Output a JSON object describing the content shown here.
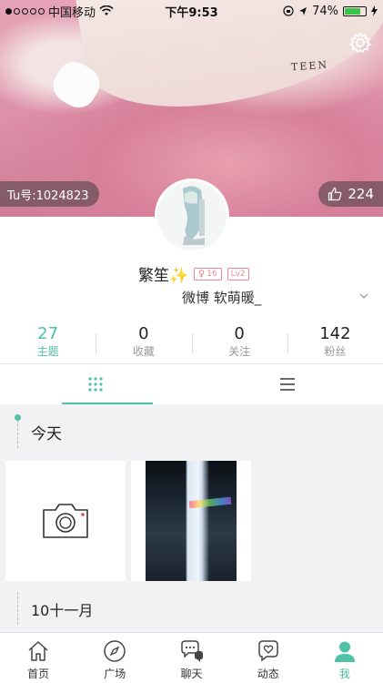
{
  "status_bar": {
    "carrier": "中国移动",
    "time": "下午9:53",
    "battery_percent": "74%",
    "signal_bars_filled": 1
  },
  "cover": {
    "tu_id": "Tu号:1024823",
    "likes": "224"
  },
  "profile": {
    "name": "繁笙✨",
    "age_badge": "16",
    "level_badge": "Lv2",
    "weibo": "微博 软萌暖_"
  },
  "stats": [
    {
      "num": "27",
      "label": "主题"
    },
    {
      "num": "0",
      "label": "收藏"
    },
    {
      "num": "0",
      "label": "关注"
    },
    {
      "num": "142",
      "label": "粉丝"
    }
  ],
  "timeline": {
    "date_today": "今天",
    "date_next": "10十一月"
  },
  "tabbar": [
    {
      "label": "首页",
      "icon": "home-icon"
    },
    {
      "label": "广场",
      "icon": "compass-icon"
    },
    {
      "label": "聊天",
      "icon": "chat-icon"
    },
    {
      "label": "动态",
      "icon": "heart-bubble-icon"
    },
    {
      "label": "我",
      "icon": "person-icon"
    }
  ],
  "colors": {
    "accent": "#4fc1a6",
    "badge_pink": "#ee8899"
  }
}
